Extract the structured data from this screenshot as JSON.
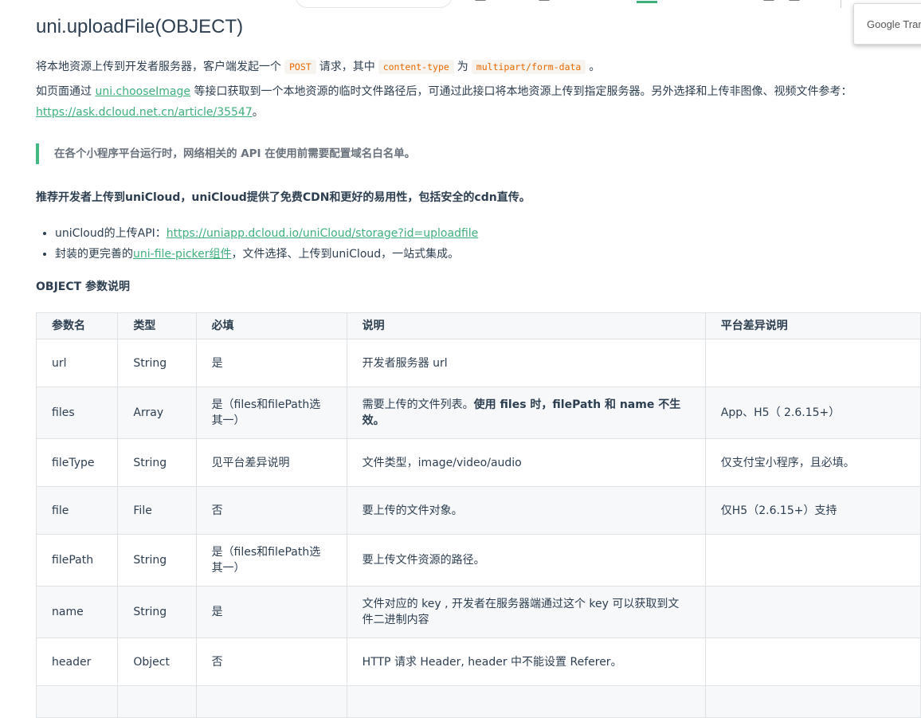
{
  "translate": {
    "label": "Google Trans"
  },
  "title": "uni.uploadFile(OBJECT)",
  "intro": {
    "p1_a": "将本地资源上传到开发者服务器，客户端发起一个",
    "p1_code1": "POST",
    "p1_b": "请求，其中",
    "p1_code2": "content-type",
    "p1_c": "为",
    "p1_code3": "multipart/form-data",
    "p1_d": "。",
    "p2_a": "如页面通过",
    "p2_link": "uni.chooseImage",
    "p2_b": "等接口获取到一个本地资源的临时文件路径后，可通过此接口将本地资源上传到指定服务器。另外选择和上传非图像、视频文件参考：",
    "p2_url": "https://ask.dcloud.net.cn/article/35547",
    "p2_c": "。"
  },
  "tip": "在各个小程序平台运行时，网络相关的 API 在使用前需要配置域名白名单。",
  "recommend": "推荐开发者上传到uniCloud，uniCloud提供了免费CDN和更好的易用性，包括安全的cdn直传。",
  "bullets": [
    {
      "text": "uniCloud的上传API：",
      "link": "https://uniapp.dcloud.io/uniCloud/storage?id=uploadfile",
      "after": ""
    },
    {
      "text": "封装的更完善的",
      "link": "uni-file-picker组件",
      "after": "，文件选择、上传到uniCloud，一站式集成。"
    }
  ],
  "section_title": "OBJECT 参数说明",
  "table": {
    "headers": [
      "参数名",
      "类型",
      "必填",
      "说明",
      "平台差异说明"
    ],
    "rows": [
      {
        "name": "url",
        "type": "String",
        "required": "是",
        "desc": "开发者服务器 url",
        "desc_bold": "",
        "platform": ""
      },
      {
        "name": "files",
        "type": "Array",
        "required": "是（files和filePath选其一）",
        "desc": "需要上传的文件列表。",
        "desc_bold": "使用 files 时，filePath 和 name 不生效。",
        "platform": "App、H5（ 2.6.15+）"
      },
      {
        "name": "fileType",
        "type": "String",
        "required": "见平台差异说明",
        "desc": "文件类型，image/video/audio",
        "desc_bold": "",
        "platform": "仅支付宝小程序，且必填。"
      },
      {
        "name": "file",
        "type": "File",
        "required": "否",
        "desc": "要上传的文件对象。",
        "desc_bold": "",
        "platform": "仅H5（2.6.15+）支持"
      },
      {
        "name": "filePath",
        "type": "String",
        "required": "是（files和filePath选其一）",
        "desc": "要上传文件资源的路径。",
        "desc_bold": "",
        "platform": ""
      },
      {
        "name": "name",
        "type": "String",
        "required": "是",
        "desc": "文件对应的 key , 开发者在服务器端通过这个 key 可以获取到文件二进制内容",
        "desc_bold": "",
        "platform": ""
      },
      {
        "name": "header",
        "type": "Object",
        "required": "否",
        "desc": "HTTP 请求 Header, header 中不能设置 Referer。",
        "desc_bold": "",
        "platform": ""
      }
    ]
  }
}
